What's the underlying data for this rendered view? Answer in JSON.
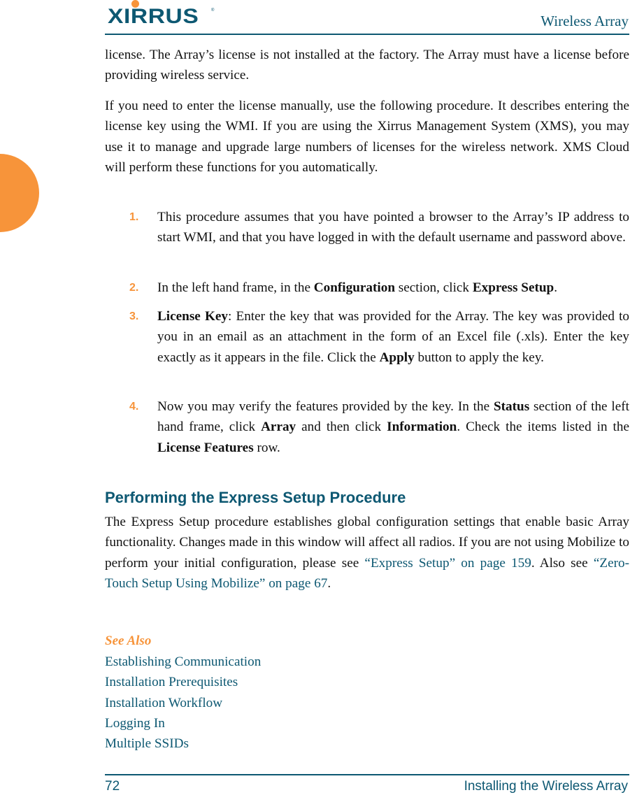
{
  "header": {
    "logo_text": "XIRRUS",
    "logo_reg": "®",
    "title": "Wireless Array"
  },
  "colors": {
    "accent_orange": "#f7943a",
    "brand_teal": "#0d5872"
  },
  "content": {
    "p1": "license. The Array’s license is not installed at the factory. The Array must have a license before providing wireless service.",
    "p2": "If you need to enter the license manually, use the following procedure. It describes entering the license key using the WMI. If you are using the Xirrus Management System (XMS), you may use it to manage and upgrade large numbers of licenses for the wireless network. XMS Cloud will perform these functions for you automatically.",
    "steps": [
      {
        "num": "1.",
        "t1": "This procedure assumes that you have pointed a browser to the Array’s IP address to start WMI, and that you have logged in with the default username and password above."
      },
      {
        "num": "2.",
        "t1": "In the left hand frame, in the ",
        "b1": "Configuration",
        "t2": " section, click ",
        "b2": "Express Setup",
        "t3": "."
      },
      {
        "num": "3.",
        "b1": "License Key",
        "t1": ": Enter the key that was provided for the Array. The key was provided to you in an email as an attachment in the form of an Excel file (.xls). Enter the key exactly as it appears in the file. Click the ",
        "b2": "Apply",
        "t2": " button to apply the key."
      },
      {
        "num": "4.",
        "t1": "Now you may verify the features provided by the key. In the ",
        "b1": "Status",
        "t2": " section of the left hand frame, click ",
        "b2": "Array",
        "t3": " and then click ",
        "b3": "Information",
        "t4": ". Check the items listed in the ",
        "b4": "License Features",
        "t5": " row."
      }
    ],
    "heading": "Performing the Express Setup Procedure",
    "p3": {
      "t1": "The Express Setup procedure establishes global configuration settings that enable basic Array functionality. Changes made in this window will affect all radios. If you are not using Mobilize to perform your initial configuration, please see ",
      "link1": "“Express Setup” on page 159",
      "t2": ". Also see ",
      "link2": "“Zero-Touch Setup Using Mobilize” on page 67",
      "t3": "."
    },
    "see_also_title": "See Also",
    "see_also": [
      "Establishing Communication",
      "Installation Prerequisites",
      "Installation Workflow",
      "Logging In",
      "Multiple SSIDs"
    ]
  },
  "footer": {
    "page_number": "72",
    "chapter_title": "Installing the Wireless Array"
  }
}
